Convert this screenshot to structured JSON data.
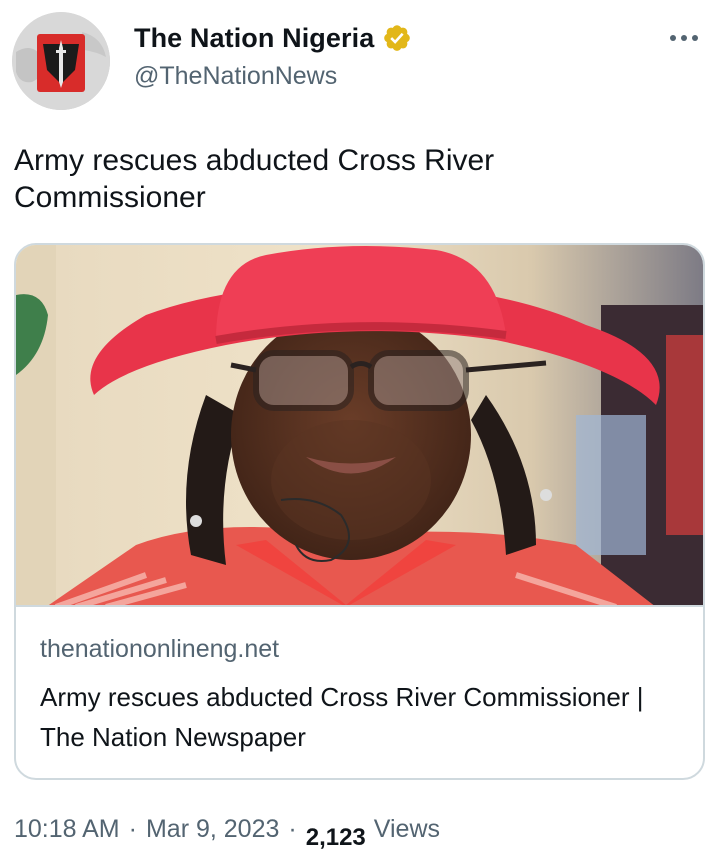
{
  "author": {
    "display_name": "The Nation Nigeria",
    "handle": "@TheNationNews",
    "verified_icon": "verified-badge-icon",
    "verified_color": "#e2b719"
  },
  "tweet": {
    "text": "Army rescues abducted Cross River Commissioner"
  },
  "card": {
    "domain": "thenationonlineng.net",
    "title": "Army rescues abducted Cross River Commissioner | The Nation Newspaper"
  },
  "meta": {
    "time": "10:18 AM",
    "separator": "·",
    "date": "Mar 9, 2023",
    "views_count": "2,123",
    "views_label": "Views"
  },
  "icons": {
    "more": "more-horizontal-icon"
  }
}
